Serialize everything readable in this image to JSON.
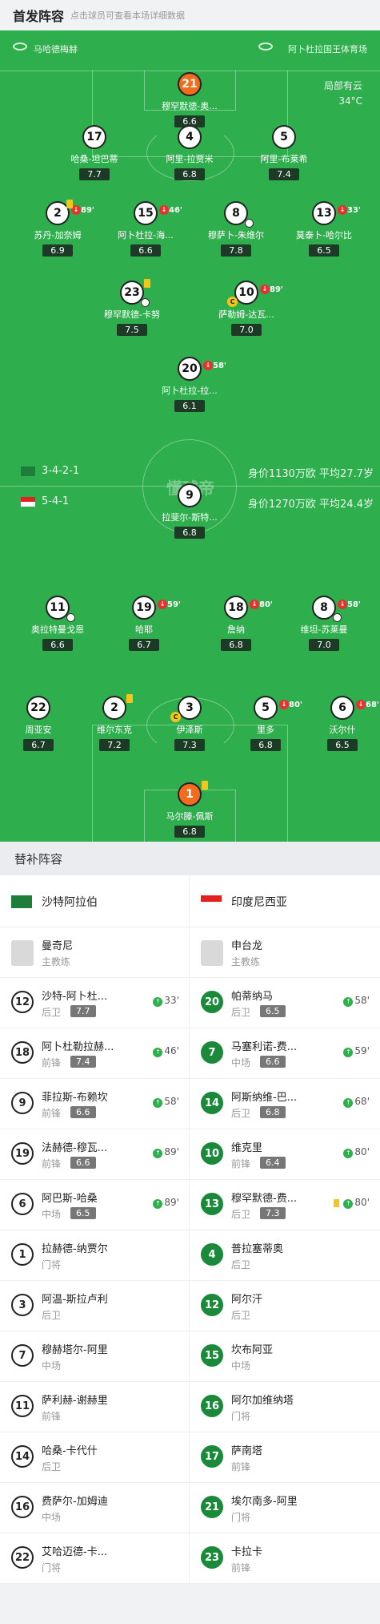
{
  "header": {
    "title": "首发阵容",
    "subtitle": "点击球员可查看本场详细数据"
  },
  "venue": {
    "left": "马哈德梅赫",
    "right": "阿卜杜拉国王体育场"
  },
  "weather": {
    "desc": "局部有云",
    "temp": "34°C"
  },
  "watermark": "懂球帝",
  "teams": {
    "home": {
      "formation": "3-4-2-1",
      "value": "身价1130万欧 平均27.7岁",
      "flag_color": "#1e7d3b"
    },
    "away": {
      "formation": "5-4-1",
      "value": "身价1270万欧 平均24.4岁",
      "flag_color": "#e0231f"
    }
  },
  "home_players": [
    {
      "num": "21",
      "name": "穆罕默德-奥...",
      "rating": "6.6",
      "gk": true
    },
    {
      "num": "17",
      "name": "哈桑-坦巴蒂",
      "rating": "7.7"
    },
    {
      "num": "4",
      "name": "阿里-拉贾米",
      "rating": "6.8"
    },
    {
      "num": "5",
      "name": "阿里-布莱希",
      "rating": "7.4"
    },
    {
      "num": "2",
      "name": "苏丹-加奈姆",
      "rating": "6.9",
      "sub": "89'",
      "yc": true
    },
    {
      "num": "15",
      "name": "阿卜杜拉-海...",
      "rating": "6.6",
      "sub": "46'"
    },
    {
      "num": "8",
      "name": "穆萨卜-朱维尔",
      "rating": "7.8",
      "ball": true,
      "star": true
    },
    {
      "num": "13",
      "name": "莫泰卜-哈尔比",
      "rating": "6.5",
      "sub": "33'"
    },
    {
      "num": "23",
      "name": "穆罕默德-卡努",
      "rating": "7.5",
      "yc": true,
      "ball": true
    },
    {
      "num": "10",
      "name": "萨勒姆-达瓦...",
      "rating": "7.0",
      "sub": "89'",
      "cap": true
    },
    {
      "num": "20",
      "name": "阿卜杜拉-拉...",
      "rating": "6.1",
      "sub": "58'"
    }
  ],
  "away_players": [
    {
      "num": "9",
      "name": "拉斐尔-斯特...",
      "rating": "6.8"
    },
    {
      "num": "11",
      "name": "奥拉特曼戈恩",
      "rating": "6.6",
      "ball": true
    },
    {
      "num": "19",
      "name": "哈耶",
      "rating": "6.7",
      "sub": "59'"
    },
    {
      "num": "18",
      "name": "詹纳",
      "rating": "6.8",
      "sub": "80'"
    },
    {
      "num": "8",
      "name": "维坦-苏莱曼",
      "rating": "7.0",
      "sub": "58'",
      "ball": true
    },
    {
      "num": "22",
      "name": "周亚安",
      "rating": "6.7"
    },
    {
      "num": "2",
      "name": "维尔东克",
      "rating": "7.2",
      "yc": true
    },
    {
      "num": "3",
      "name": "伊泽斯",
      "rating": "7.3",
      "cap": true
    },
    {
      "num": "5",
      "name": "里多",
      "rating": "6.8",
      "sub": "80'"
    },
    {
      "num": "6",
      "name": "沃尔什",
      "rating": "6.5",
      "sub": "68'"
    },
    {
      "num": "1",
      "name": "马尔滕-佩斯",
      "rating": "6.8",
      "gk": true,
      "yc": true
    }
  ],
  "subs_section": {
    "title": "替补阵容"
  },
  "subs_teams": {
    "home": "沙特阿拉伯",
    "away": "印度尼西亚"
  },
  "coaches": {
    "home": {
      "name": "曼奇尼",
      "role": "主教练"
    },
    "away": {
      "name": "申台龙",
      "role": "主教练"
    }
  },
  "sub_rows": [
    [
      {
        "num": "12",
        "name": "沙特-阿卜杜...",
        "pos": "后卫",
        "rating": "7.7",
        "min": "33'"
      },
      {
        "num": "20",
        "name": "帕蒂纳马",
        "pos": "后卫",
        "rating": "6.5",
        "min": "58'"
      }
    ],
    [
      {
        "num": "18",
        "name": "阿卜杜勒拉赫...",
        "pos": "前锋",
        "rating": "7.4",
        "min": "46'"
      },
      {
        "num": "7",
        "name": "马塞利诺-费...",
        "pos": "中场",
        "rating": "6.6",
        "min": "59'"
      }
    ],
    [
      {
        "num": "9",
        "name": "菲拉斯-布赖坎",
        "pos": "前锋",
        "rating": "6.6",
        "min": "58'"
      },
      {
        "num": "14",
        "name": "阿斯纳维-巴...",
        "pos": "后卫",
        "rating": "6.8",
        "min": "68'"
      }
    ],
    [
      {
        "num": "19",
        "name": "法赫德-穆瓦...",
        "pos": "前锋",
        "rating": "6.6",
        "min": "89'"
      },
      {
        "num": "10",
        "name": "维克里",
        "pos": "前锋",
        "rating": "6.4",
        "min": "80'"
      }
    ],
    [
      {
        "num": "6",
        "name": "阿巴斯-哈桑",
        "pos": "中场",
        "rating": "6.5",
        "min": "89'"
      },
      {
        "num": "13",
        "name": "穆罕默德-费...",
        "pos": "后卫",
        "rating": "7.3",
        "min": "80'",
        "yc": true
      }
    ],
    [
      {
        "num": "1",
        "name": "拉赫德-纳贾尔",
        "pos": "门将"
      },
      {
        "num": "4",
        "name": "普拉塞蒂奥",
        "pos": "后卫"
      }
    ],
    [
      {
        "num": "3",
        "name": "阿温-斯拉卢利",
        "pos": "后卫"
      },
      {
        "num": "12",
        "name": "阿尔汗",
        "pos": "后卫"
      }
    ],
    [
      {
        "num": "7",
        "name": "穆赫塔尔-阿里",
        "pos": "中场"
      },
      {
        "num": "15",
        "name": "坎布阿亚",
        "pos": "中场"
      }
    ],
    [
      {
        "num": "11",
        "name": "萨利赫-谢赫里",
        "pos": "前锋"
      },
      {
        "num": "16",
        "name": "阿尔加维纳塔",
        "pos": "门将"
      }
    ],
    [
      {
        "num": "14",
        "name": "哈桑-卡代什",
        "pos": "后卫"
      },
      {
        "num": "17",
        "name": "萨南塔",
        "pos": "前锋"
      }
    ],
    [
      {
        "num": "16",
        "name": "费萨尔-加姆迪",
        "pos": "中场"
      },
      {
        "num": "21",
        "name": "埃尔南多-阿里",
        "pos": "门将"
      }
    ],
    [
      {
        "num": "22",
        "name": "艾哈迈德-卡...",
        "pos": "门将"
      },
      {
        "num": "23",
        "name": "卡拉卡",
        "pos": "前锋"
      }
    ]
  ]
}
